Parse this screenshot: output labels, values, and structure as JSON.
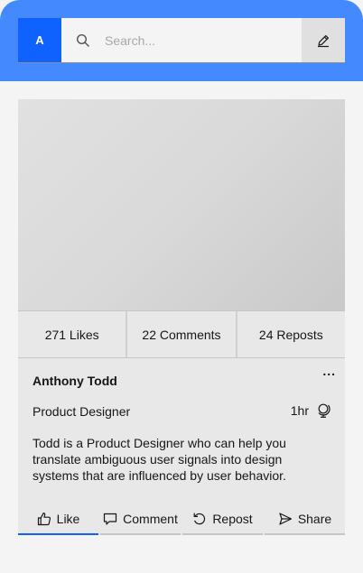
{
  "header": {
    "avatar_letter": "A",
    "search_placeholder": "Search..."
  },
  "post": {
    "stats": {
      "likes": "271 Likes",
      "comments": "22 Comments",
      "reposts": "24 Reposts"
    },
    "menu_label": "...",
    "author": "Anthony Todd",
    "role": "Product Designer",
    "time": "1hr",
    "description": "Todd is a Product Designer who can help you translate ambiguous user signals into design systems that are influenced by user behavior."
  },
  "actions": {
    "like": "Like",
    "comment": "Comment",
    "repost": "Repost",
    "share": "Share"
  },
  "colors": {
    "header_bg": "#4589ff",
    "accent": "#0f62fe",
    "card_bg": "#e8e8e8"
  }
}
